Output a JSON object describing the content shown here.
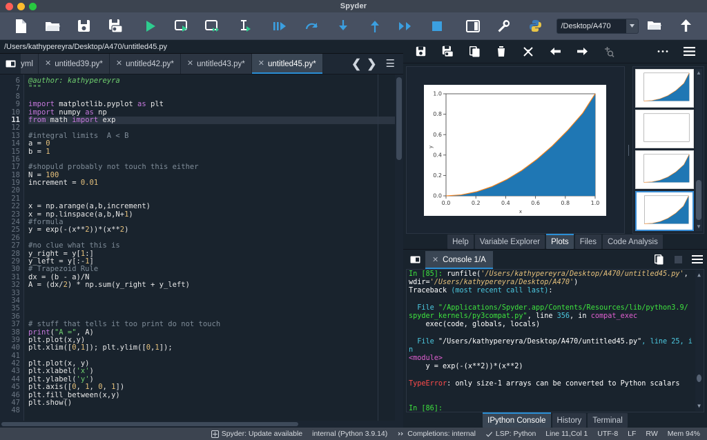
{
  "window": {
    "title": "Spyder",
    "traffic_lights": [
      "close",
      "minimize",
      "zoom"
    ]
  },
  "toolbar": {
    "buttons": [
      {
        "name": "new-file-icon",
        "tooltip": "New file"
      },
      {
        "name": "open-file-icon",
        "tooltip": "Open file"
      },
      {
        "name": "save-file-icon",
        "tooltip": "Save file"
      },
      {
        "name": "save-all-icon",
        "tooltip": "Save all"
      },
      {
        "name": "run-file-icon",
        "tooltip": "Run file"
      },
      {
        "name": "run-cell-icon",
        "tooltip": "Run current cell"
      },
      {
        "name": "run-cell-advance-icon",
        "tooltip": "Run cell and advance"
      },
      {
        "name": "run-selection-icon",
        "tooltip": "Run selection"
      },
      {
        "name": "debug-file-icon",
        "tooltip": "Debug file"
      },
      {
        "name": "step-over-icon",
        "tooltip": "Run current line"
      },
      {
        "name": "step-into-icon",
        "tooltip": "Step into function"
      },
      {
        "name": "step-return-icon",
        "tooltip": "Run until return"
      },
      {
        "name": "continue-icon",
        "tooltip": "Continue execution"
      },
      {
        "name": "stop-debug-icon",
        "tooltip": "Stop debugging"
      },
      {
        "name": "panes-layout-icon",
        "tooltip": "Panes layout"
      },
      {
        "name": "preferences-icon",
        "tooltip": "Preferences"
      },
      {
        "name": "pythonpath-icon",
        "tooltip": "PYTHONPATH manager"
      }
    ],
    "working_directory": "/Desktop/A470",
    "browse_dir_icon": "open-folder-icon",
    "parent_dir_icon": "arrow-up-icon"
  },
  "editor": {
    "path": "/Users/kathypereyra/Desktop/A470/untitled45.py",
    "browse_tabs_icon": "browse-tabs-icon",
    "tabs": [
      {
        "label": "yml",
        "modified": false,
        "active": false,
        "clipped": true
      },
      {
        "label": "untitled39.py*",
        "modified": true,
        "active": false
      },
      {
        "label": "untitled42.py*",
        "modified": true,
        "active": false
      },
      {
        "label": "untitled43.py*",
        "modified": true,
        "active": false
      },
      {
        "label": "untitled45.py*",
        "modified": true,
        "active": true
      }
    ],
    "nav": {
      "prev_icon": "chevron-left-icon",
      "next_icon": "chevron-right-icon",
      "options_icon": "hamburger-menu-icon"
    },
    "first_line_number": 6,
    "current_line": 11,
    "lines": [
      {
        "n": 6,
        "tokens": [
          {
            "t": "@author: kathypereyra",
            "c": "dc"
          }
        ]
      },
      {
        "n": 7,
        "tokens": [
          {
            "t": "\"\"\"",
            "c": "dc"
          }
        ]
      },
      {
        "n": 8,
        "tokens": [
          {
            "t": "",
            "c": ""
          }
        ]
      },
      {
        "n": 9,
        "tokens": [
          {
            "t": "import",
            "c": "k"
          },
          {
            "t": " matplotlib.pyplot ",
            "c": ""
          },
          {
            "t": "as",
            "c": "k"
          },
          {
            "t": " plt",
            "c": ""
          }
        ]
      },
      {
        "n": 10,
        "tokens": [
          {
            "t": "import",
            "c": "k"
          },
          {
            "t": " numpy ",
            "c": ""
          },
          {
            "t": "as",
            "c": "k"
          },
          {
            "t": " np",
            "c": ""
          }
        ]
      },
      {
        "n": 11,
        "tokens": [
          {
            "t": "from",
            "c": "k"
          },
          {
            "t": " math ",
            "c": ""
          },
          {
            "t": "import",
            "c": "k"
          },
          {
            "t": " exp",
            "c": ""
          }
        ]
      },
      {
        "n": 12,
        "tokens": [
          {
            "t": "",
            "c": ""
          }
        ]
      },
      {
        "n": 13,
        "tokens": [
          {
            "t": "#integral limits  A < B",
            "c": "cm"
          }
        ]
      },
      {
        "n": 14,
        "tokens": [
          {
            "t": "a = ",
            "c": ""
          },
          {
            "t": "0",
            "c": "n"
          }
        ]
      },
      {
        "n": 15,
        "tokens": [
          {
            "t": "b = ",
            "c": ""
          },
          {
            "t": "1",
            "c": "n"
          }
        ]
      },
      {
        "n": 16,
        "tokens": [
          {
            "t": "",
            "c": ""
          }
        ]
      },
      {
        "n": 17,
        "tokens": [
          {
            "t": "#shopuld probably not touch this either",
            "c": "cm"
          }
        ]
      },
      {
        "n": 18,
        "tokens": [
          {
            "t": "N = ",
            "c": ""
          },
          {
            "t": "100",
            "c": "n"
          }
        ]
      },
      {
        "n": 19,
        "tokens": [
          {
            "t": "increment = ",
            "c": ""
          },
          {
            "t": "0.01",
            "c": "n"
          }
        ]
      },
      {
        "n": 20,
        "tokens": [
          {
            "t": "",
            "c": ""
          }
        ]
      },
      {
        "n": 21,
        "tokens": [
          {
            "t": "",
            "c": ""
          }
        ]
      },
      {
        "n": 22,
        "tokens": [
          {
            "t": "x = np.arange(a,b,increment)",
            "c": ""
          }
        ]
      },
      {
        "n": 23,
        "tokens": [
          {
            "t": "x = np.linspace(a,b,N+",
            "c": ""
          },
          {
            "t": "1",
            "c": "n"
          },
          {
            "t": ")",
            "c": ""
          }
        ]
      },
      {
        "n": 24,
        "tokens": [
          {
            "t": "#formula",
            "c": "cm"
          }
        ]
      },
      {
        "n": 25,
        "tokens": [
          {
            "t": "y = exp(-(x**",
            "c": ""
          },
          {
            "t": "2",
            "c": "n"
          },
          {
            "t": "))*(x**",
            "c": ""
          },
          {
            "t": "2",
            "c": "n"
          },
          {
            "t": ")",
            "c": ""
          }
        ]
      },
      {
        "n": 26,
        "tokens": [
          {
            "t": "",
            "c": ""
          }
        ]
      },
      {
        "n": 27,
        "tokens": [
          {
            "t": "#no clue what this is",
            "c": "cm"
          }
        ]
      },
      {
        "n": 28,
        "tokens": [
          {
            "t": "y_right = y[",
            "c": ""
          },
          {
            "t": "1",
            "c": "n"
          },
          {
            "t": ":]",
            "c": ""
          }
        ]
      },
      {
        "n": 29,
        "tokens": [
          {
            "t": "y_left = y[:-",
            "c": ""
          },
          {
            "t": "1",
            "c": "n"
          },
          {
            "t": "]",
            "c": ""
          }
        ]
      },
      {
        "n": 30,
        "tokens": [
          {
            "t": "# Trapezoid Rule",
            "c": "cm"
          }
        ]
      },
      {
        "n": 31,
        "tokens": [
          {
            "t": "dx = (b - a)/N",
            "c": ""
          }
        ]
      },
      {
        "n": 32,
        "tokens": [
          {
            "t": "A = (dx/",
            "c": ""
          },
          {
            "t": "2",
            "c": "n"
          },
          {
            "t": ") * np.sum(y_right + y_left)",
            "c": ""
          }
        ]
      },
      {
        "n": 33,
        "tokens": [
          {
            "t": "",
            "c": ""
          }
        ]
      },
      {
        "n": 34,
        "tokens": [
          {
            "t": "",
            "c": ""
          }
        ]
      },
      {
        "n": 35,
        "tokens": [
          {
            "t": "",
            "c": ""
          }
        ]
      },
      {
        "n": 36,
        "tokens": [
          {
            "t": "",
            "c": ""
          }
        ]
      },
      {
        "n": 37,
        "tokens": [
          {
            "t": "# stuff that tells it too print do not touch",
            "c": "cm"
          }
        ]
      },
      {
        "n": 38,
        "tokens": [
          {
            "t": "print",
            "c": "fn"
          },
          {
            "t": "(",
            "c": ""
          },
          {
            "t": "\"A =\"",
            "c": "s"
          },
          {
            "t": ", A)",
            "c": ""
          }
        ]
      },
      {
        "n": 39,
        "tokens": [
          {
            "t": "plt.plot(x,y)",
            "c": ""
          }
        ]
      },
      {
        "n": 40,
        "tokens": [
          {
            "t": "plt.xlim([",
            "c": ""
          },
          {
            "t": "0",
            "c": "n"
          },
          {
            "t": ",",
            "c": ""
          },
          {
            "t": "1",
            "c": "n"
          },
          {
            "t": "]); plt.ylim([",
            "c": ""
          },
          {
            "t": "0",
            "c": "n"
          },
          {
            "t": ",",
            "c": ""
          },
          {
            "t": "1",
            "c": "n"
          },
          {
            "t": "]);",
            "c": ""
          }
        ]
      },
      {
        "n": 41,
        "tokens": [
          {
            "t": "",
            "c": ""
          }
        ]
      },
      {
        "n": 42,
        "tokens": [
          {
            "t": "plt.plot(x, y)",
            "c": ""
          }
        ]
      },
      {
        "n": 43,
        "tokens": [
          {
            "t": "plt.xlabel(",
            "c": ""
          },
          {
            "t": "'x'",
            "c": "s"
          },
          {
            "t": ")",
            "c": ""
          }
        ]
      },
      {
        "n": 44,
        "tokens": [
          {
            "t": "plt.ylabel(",
            "c": ""
          },
          {
            "t": "'y'",
            "c": "s"
          },
          {
            "t": ")",
            "c": ""
          }
        ]
      },
      {
        "n": 45,
        "tokens": [
          {
            "t": "plt.axis([",
            "c": ""
          },
          {
            "t": "0",
            "c": "n"
          },
          {
            "t": ", ",
            "c": ""
          },
          {
            "t": "1",
            "c": "n"
          },
          {
            "t": ", ",
            "c": ""
          },
          {
            "t": "0",
            "c": "n"
          },
          {
            "t": ", ",
            "c": ""
          },
          {
            "t": "1",
            "c": "n"
          },
          {
            "t": "])",
            "c": ""
          }
        ]
      },
      {
        "n": 46,
        "tokens": [
          {
            "t": "plt.fill_between(x,y)",
            "c": ""
          }
        ]
      },
      {
        "n": 47,
        "tokens": [
          {
            "t": "plt.show()",
            "c": ""
          }
        ]
      },
      {
        "n": 48,
        "tokens": [
          {
            "t": "",
            "c": ""
          }
        ]
      }
    ]
  },
  "plots": {
    "toolbar": [
      {
        "name": "save-plot-icon"
      },
      {
        "name": "save-all-plots-icon"
      },
      {
        "name": "copy-plot-icon"
      },
      {
        "name": "delete-plot-icon"
      },
      {
        "name": "delete-all-plots-icon"
      },
      {
        "name": "previous-plot-icon"
      },
      {
        "name": "next-plot-icon"
      },
      {
        "name": "zoom-plot-icon"
      },
      {
        "name": "more-options-icon"
      },
      {
        "name": "plots-menu-icon"
      }
    ],
    "thumbnails": [
      {
        "index": 1,
        "empty": false,
        "selected": false
      },
      {
        "index": 2,
        "empty": true,
        "selected": false
      },
      {
        "index": 3,
        "empty": false,
        "selected": false
      },
      {
        "index": 4,
        "empty": false,
        "selected": true
      }
    ],
    "pane_tabs": [
      {
        "label": "Help",
        "active": false
      },
      {
        "label": "Variable Explorer",
        "active": false
      },
      {
        "label": "Plots",
        "active": true
      },
      {
        "label": "Files",
        "active": false
      },
      {
        "label": "Code Analysis",
        "active": false
      }
    ]
  },
  "chart_data": {
    "type": "area",
    "title": "",
    "xlabel": "x",
    "ylabel": "y",
    "xlim": [
      0.0,
      1.0
    ],
    "ylim": [
      0.0,
      1.0
    ],
    "xticks": [
      "0.0",
      "0.2",
      "0.4",
      "0.6",
      "0.8",
      "1.0"
    ],
    "yticks": [
      "0.0",
      "0.2",
      "0.4",
      "0.6",
      "0.8",
      "1.0"
    ],
    "grid": false,
    "legend": null,
    "line_color": "#ff7f0e",
    "fill_color": "#1f77b4",
    "fill_mode": "between_curve_and_right_edge",
    "x": [
      0.0,
      0.1,
      0.2,
      0.3,
      0.4,
      0.5,
      0.6,
      0.7,
      0.8,
      0.9,
      1.0
    ],
    "y": [
      0.0,
      0.01,
      0.04,
      0.09,
      0.16,
      0.25,
      0.36,
      0.49,
      0.64,
      0.81,
      1.0
    ]
  },
  "console": {
    "browse_icon": "browse-consoles-icon",
    "tab": {
      "label": "Console 1/A",
      "close_icon": "close-icon"
    },
    "header_icons": [
      {
        "name": "new-console-icon"
      },
      {
        "name": "stop-console-icon"
      },
      {
        "name": "console-menu-icon"
      }
    ],
    "lines": [
      [
        {
          "t": "In [85]:",
          "c": "c-in"
        },
        {
          "t": " runfile(",
          "c": "c-white"
        },
        {
          "t": "'/Users/kathypereyra/Desktop/A470/untitled45.py'",
          "c": "c-str"
        },
        {
          "t": ",",
          "c": "c-white"
        }
      ],
      [
        {
          "t": "wdir=",
          "c": "c-white"
        },
        {
          "t": "'/Users/kathypereyra/Desktop/A470'",
          "c": "c-str"
        },
        {
          "t": ")",
          "c": "c-white"
        }
      ],
      [
        {
          "t": "Traceback ",
          "c": "c-white"
        },
        {
          "t": "(most recent call last)",
          "c": "c-cy"
        },
        {
          "t": ":",
          "c": "c-white"
        }
      ],
      [
        {
          "t": "",
          "c": ""
        }
      ],
      [
        {
          "t": "  File ",
          "c": "c-cy"
        },
        {
          "t": "\"/Applications/Spyder.app/Contents/Resources/lib/python3.9/",
          "c": "c-path"
        }
      ],
      [
        {
          "t": "spyder_kernels/py3compat.py\"",
          "c": "c-path"
        },
        {
          "t": ", line ",
          "c": "c-white"
        },
        {
          "t": "356",
          "c": "c-num"
        },
        {
          "t": ", in ",
          "c": "c-white"
        },
        {
          "t": "compat_exec",
          "c": "c-mag"
        }
      ],
      [
        {
          "t": "    exec(code, globals, locals)",
          "c": "c-white"
        }
      ],
      [
        {
          "t": "",
          "c": ""
        }
      ],
      [
        {
          "t": "  File ",
          "c": "c-cy"
        },
        {
          "t": "\"/Users/kathypereyra/Desktop/A470/untitled45.py\"",
          "c": "c-white"
        },
        {
          "t": ", line ",
          "c": "c-cy"
        },
        {
          "t": "25",
          "c": "c-cy"
        },
        {
          "t": ", in",
          "c": "c-cy"
        }
      ],
      [
        {
          "t": "<module>",
          "c": "c-mag"
        }
      ],
      [
        {
          "t": "    y = exp(-(x**2))*(x**2)",
          "c": "c-white"
        }
      ],
      [
        {
          "t": "",
          "c": ""
        }
      ],
      [
        {
          "t": "TypeError",
          "c": "c-err"
        },
        {
          "t": ": only size-1 arrays can be converted to Python scalars",
          "c": "c-white"
        }
      ],
      [
        {
          "t": "",
          "c": ""
        }
      ],
      [
        {
          "t": "",
          "c": ""
        }
      ],
      [
        {
          "t": "In [86]:",
          "c": "c-in"
        }
      ]
    ],
    "bottom_tabs": [
      {
        "label": "IPython Console",
        "active": true
      },
      {
        "label": "History",
        "active": false
      },
      {
        "label": "Terminal",
        "active": false
      }
    ]
  },
  "statusbar": {
    "items": [
      {
        "icon": "spyder-logo-icon",
        "label": "Spyder: Update available"
      },
      {
        "icon": null,
        "label": "internal (Python 3.9.14)"
      },
      {
        "icon": "completions-icon",
        "label": "Completions: internal"
      },
      {
        "icon": "check-icon",
        "label": "LSP: Python"
      },
      {
        "icon": null,
        "label": "Line 11,Col 1"
      },
      {
        "icon": null,
        "label": "UTF-8"
      },
      {
        "icon": null,
        "label": "LF"
      },
      {
        "icon": null,
        "label": "RW"
      },
      {
        "icon": null,
        "label": "Mem 94%"
      }
    ]
  }
}
